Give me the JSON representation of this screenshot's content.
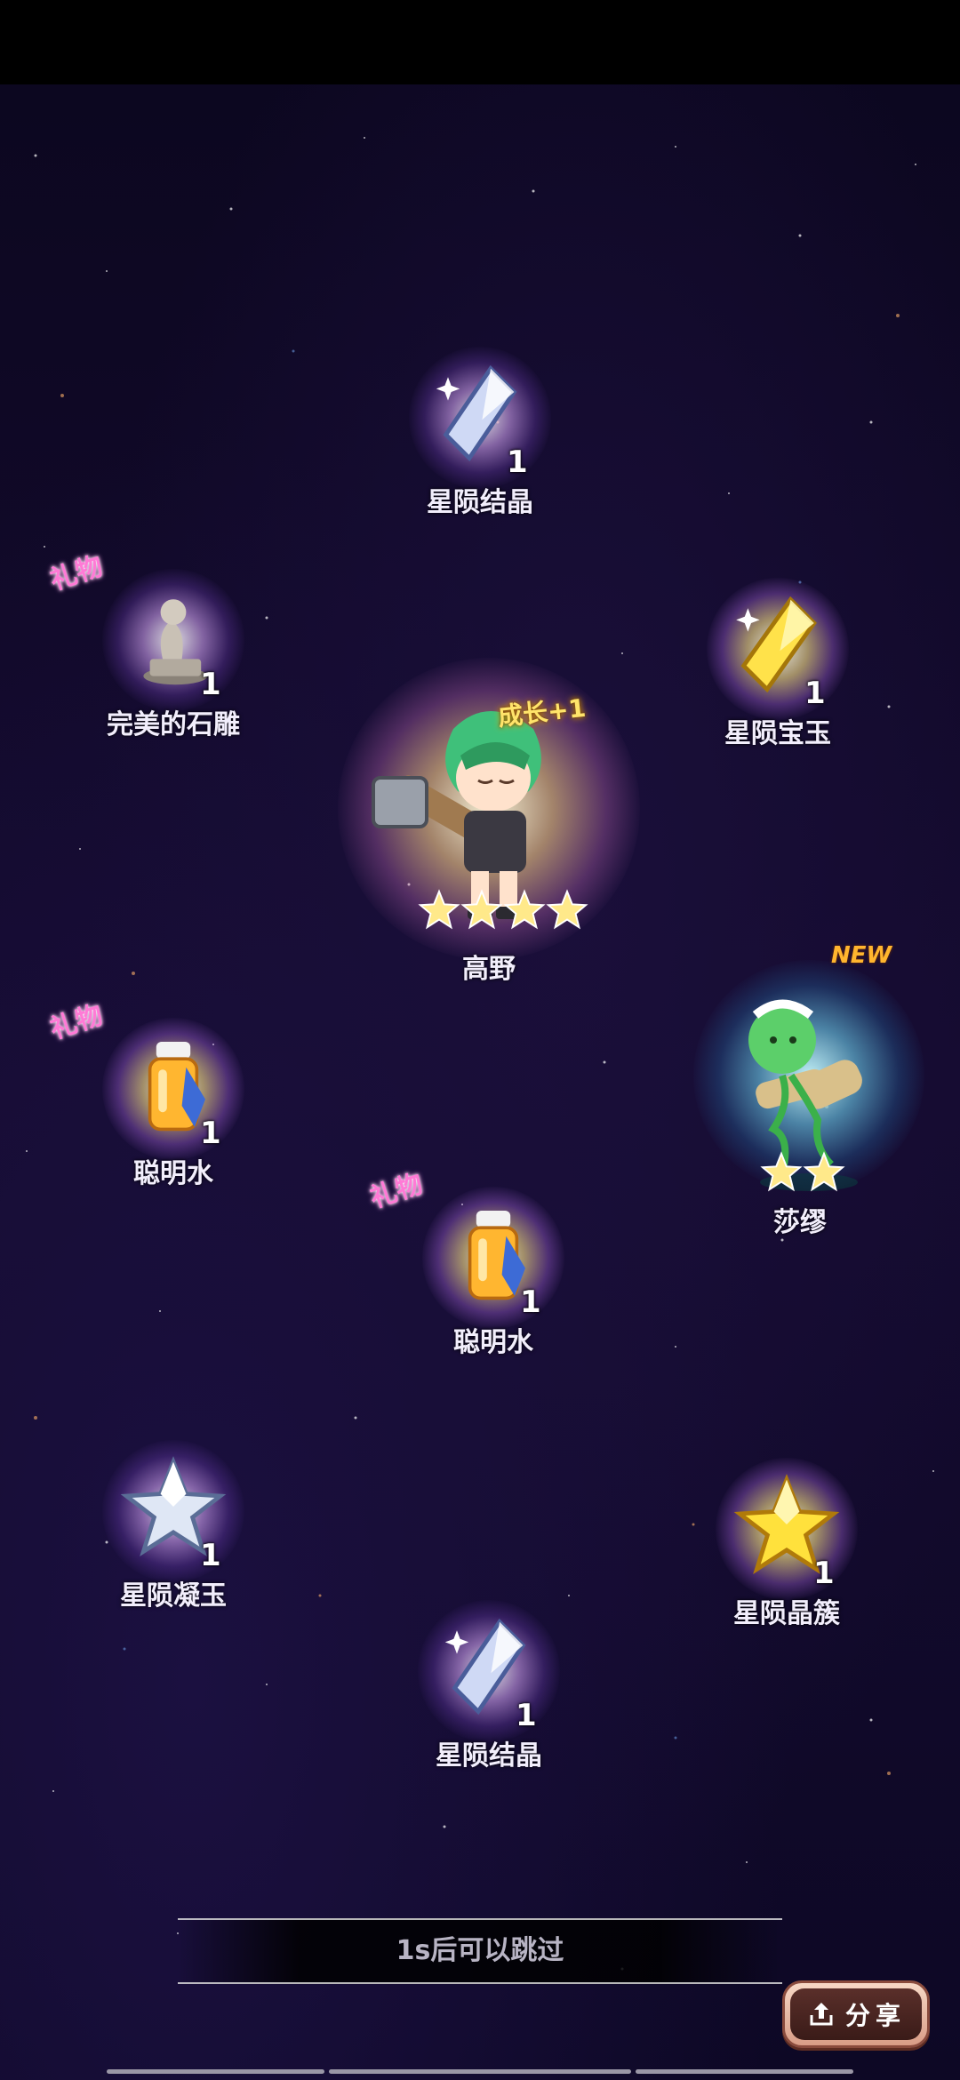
{
  "items": [
    {
      "label": "星陨结晶",
      "count": "1",
      "icon": "crystal-blue-icon",
      "gift": ""
    },
    {
      "label": "完美的石雕",
      "count": "1",
      "icon": "stone-statue-icon",
      "gift": "礼物"
    },
    {
      "label": "星陨宝玉",
      "count": "1",
      "icon": "crystal-gold-icon",
      "gift": ""
    },
    {
      "label": "聪明水",
      "count": "1",
      "icon": "potion-icon",
      "gift": "礼物"
    },
    {
      "label": "聪明水",
      "count": "1",
      "icon": "potion-icon",
      "gift": "礼物"
    },
    {
      "label": "星陨凝玉",
      "count": "1",
      "icon": "star-silver-icon",
      "gift": ""
    },
    {
      "label": "星陨晶簇",
      "count": "1",
      "icon": "star-gold-icon",
      "gift": ""
    },
    {
      "label": "星陨结晶",
      "count": "1",
      "icon": "crystal-blue-icon",
      "gift": ""
    }
  ],
  "characters": [
    {
      "name": "高野",
      "stars": 4,
      "growth_text": "成长+1",
      "icon": "green-hair-warrior-icon"
    },
    {
      "name": "莎缪",
      "stars": 2,
      "badge": "NEW",
      "icon": "green-sprite-icon"
    }
  ],
  "skip": {
    "text": "1s后可以跳过"
  },
  "share": {
    "label": "分享",
    "icon": "share-icon"
  },
  "colors": {
    "gift": "#ff7ad6",
    "new_badge": "#ffb52e",
    "growth": "#ffe46a"
  }
}
